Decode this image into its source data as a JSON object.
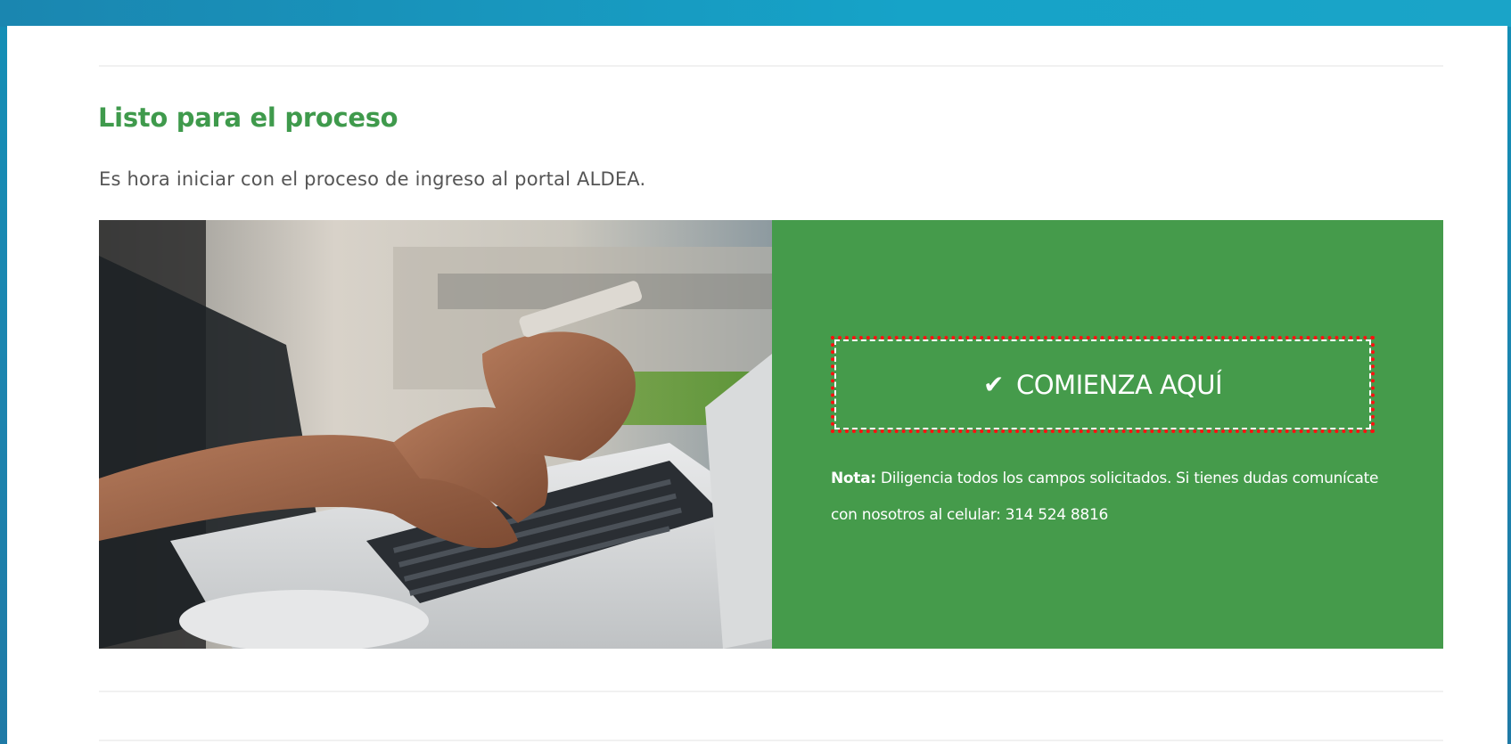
{
  "section": {
    "title": "Listo para el proceso",
    "description": "Es hora iniciar con el proceso de ingreso al portal ALDEA."
  },
  "card": {
    "image_alt_icon": "laptop-phone-photo",
    "cta": {
      "icon": "check-icon",
      "label": "COMIENZA AQUÍ"
    },
    "note": {
      "prefix": "Nota:",
      "text": " Diligencia todos los campos solicitados. Si tienes dudas comunícate con nosotros al celular: 314 524 8816"
    }
  },
  "colors": {
    "accent_green": "#459b4b",
    "title_green": "#3f9a4c",
    "frame_blue": "#1a8fb7",
    "highlight_red": "#ff1010"
  }
}
